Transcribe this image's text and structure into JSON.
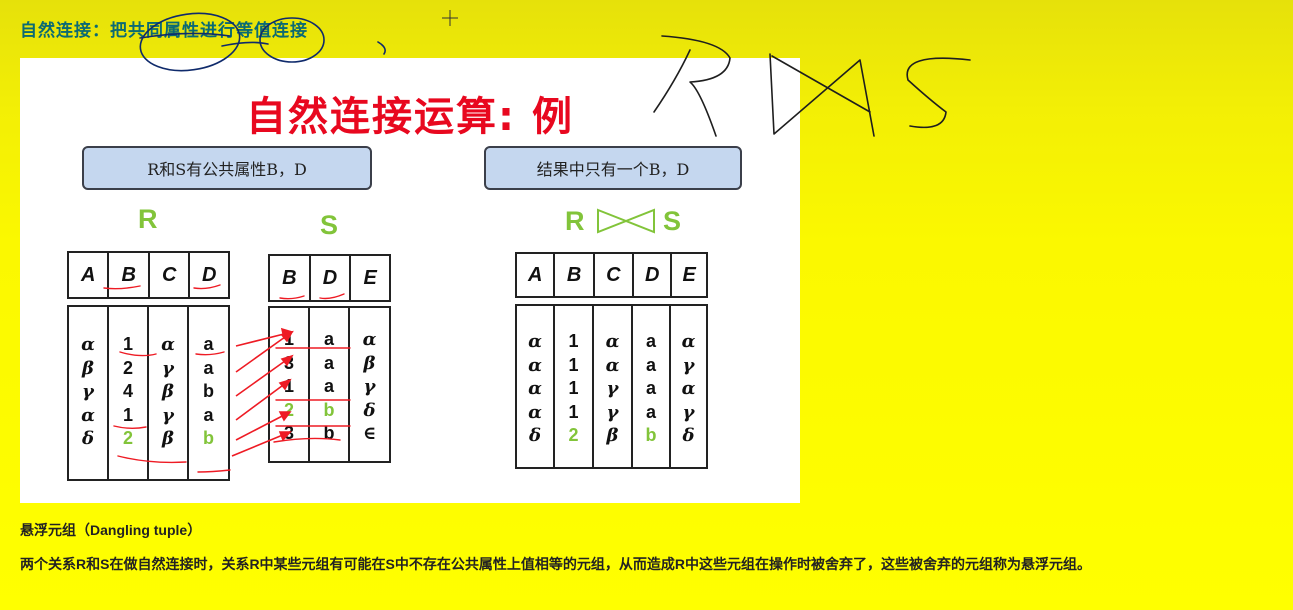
{
  "heading": "自然连接：把共同属性进行等值连接",
  "slide": {
    "title": "自然连接运算: 例",
    "callout_left": "R和S有公共属性B，D",
    "callout_right": "结果中只有一个B，D",
    "label_r": "R",
    "label_s": "S",
    "label_join_left": "R",
    "label_join_right": "S"
  },
  "tables": {
    "R": {
      "headers": [
        "A",
        "B",
        "C",
        "D"
      ],
      "rows": [
        [
          "α",
          "1",
          "α",
          "a"
        ],
        [
          "β",
          "2",
          "γ",
          "a"
        ],
        [
          "γ",
          "4",
          "β",
          "b"
        ],
        [
          "α",
          "1",
          "γ",
          "a"
        ],
        [
          "δ",
          "2",
          "β",
          "b"
        ]
      ]
    },
    "S": {
      "headers": [
        "B",
        "D",
        "E"
      ],
      "rows": [
        [
          "1",
          "a",
          "α"
        ],
        [
          "3",
          "a",
          "β"
        ],
        [
          "1",
          "a",
          "γ"
        ],
        [
          "2",
          "b",
          "δ"
        ],
        [
          "3",
          "b",
          "∈"
        ]
      ]
    },
    "Result": {
      "headers": [
        "A",
        "B",
        "C",
        "D",
        "E"
      ],
      "rows": [
        [
          "α",
          "1",
          "α",
          "a",
          "α"
        ],
        [
          "α",
          "1",
          "α",
          "a",
          "γ"
        ],
        [
          "α",
          "1",
          "γ",
          "a",
          "α"
        ],
        [
          "α",
          "1",
          "γ",
          "a",
          "γ"
        ],
        [
          "δ",
          "2",
          "β",
          "b",
          "δ"
        ]
      ]
    }
  },
  "handwriting_text": "R⋈S",
  "footer": {
    "title": "悬浮元组（Dangling tuple）",
    "text": "两个关系R和S在做自然连接时，关系R中某些元组有可能在S中不存在公共属性上值相等的元组，从而造成R中这些元组在操作时被舍弃了，这些被舍弃的元组称为悬浮元组。"
  },
  "colors": {
    "background": "#ffff00",
    "heading": "#0b6a73",
    "title_red": "#e8081f",
    "label_green": "#82c43a",
    "callout_fill": "#c5d7ef",
    "annotation_red": "#ee1b24"
  }
}
